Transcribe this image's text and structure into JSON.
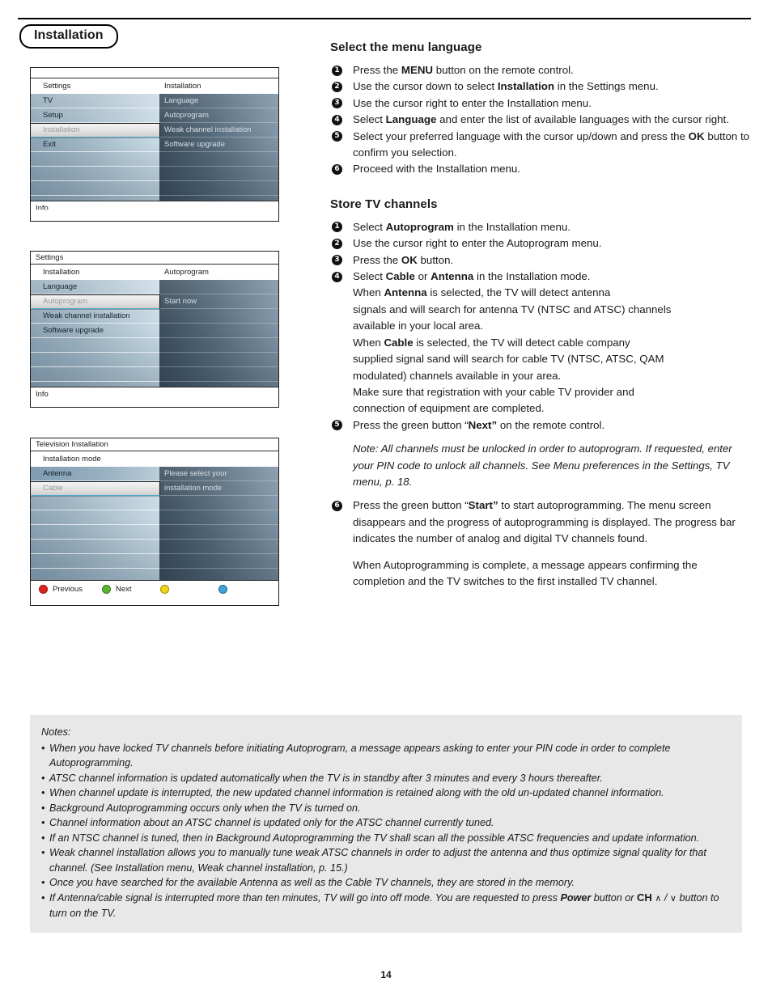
{
  "header": {
    "page_title": "Installation"
  },
  "tv_menus": [
    {
      "name": "settings-installation-menu",
      "title": "",
      "col_head_left": "Settings",
      "col_head_right": "Installation",
      "left_items": [
        {
          "label": "TV",
          "state": "normal"
        },
        {
          "label": "Setup",
          "state": "normal"
        },
        {
          "label": "Installation",
          "state": "selected"
        },
        {
          "label": "Exit",
          "state": "normal"
        },
        {
          "label": "",
          "state": "blank"
        },
        {
          "label": "",
          "state": "blank"
        },
        {
          "label": "",
          "state": "blank"
        },
        {
          "label": "",
          "state": "blank"
        }
      ],
      "right_items": [
        {
          "label": "Language",
          "state": "normal"
        },
        {
          "label": "Autoprogram",
          "state": "normal"
        },
        {
          "label": "Weak channel installation",
          "state": "normal"
        },
        {
          "label": "Software upgrade",
          "state": "normal"
        },
        {
          "label": "",
          "state": "blank"
        },
        {
          "label": "",
          "state": "blank"
        },
        {
          "label": "",
          "state": "blank"
        },
        {
          "label": "",
          "state": "blank"
        }
      ],
      "info_label": "Info"
    },
    {
      "name": "autoprogram-menu",
      "title": "Settings",
      "col_head_left": "Installation",
      "col_head_right": "Autoprogram",
      "left_items": [
        {
          "label": "Language",
          "state": "normal"
        },
        {
          "label": "Autoprogram",
          "state": "selected"
        },
        {
          "label": "Weak channel installation",
          "state": "normal"
        },
        {
          "label": "Software upgrade",
          "state": "normal"
        },
        {
          "label": "",
          "state": "blank"
        },
        {
          "label": "",
          "state": "blank"
        },
        {
          "label": "",
          "state": "blank"
        }
      ],
      "right_items": [
        {
          "label": "",
          "state": "blank"
        },
        {
          "label": "Start now",
          "state": "normal"
        },
        {
          "label": "",
          "state": "blank"
        },
        {
          "label": "",
          "state": "blank"
        },
        {
          "label": "",
          "state": "blank"
        },
        {
          "label": "",
          "state": "blank"
        },
        {
          "label": "",
          "state": "blank"
        }
      ],
      "info_label": "Info"
    },
    {
      "name": "television-installation-menu",
      "title": "Television Installation",
      "col_head_left": "Installation mode",
      "col_head_right": "",
      "left_items": [
        {
          "label": "Antenna",
          "state": "highlight"
        },
        {
          "label": "Cable",
          "state": "selected"
        },
        {
          "label": "",
          "state": "blank"
        },
        {
          "label": "",
          "state": "blank"
        },
        {
          "label": "",
          "state": "blank"
        },
        {
          "label": "",
          "state": "blank"
        },
        {
          "label": "",
          "state": "blank"
        }
      ],
      "right_items": [
        {
          "label": "Please select your",
          "state": "normal"
        },
        {
          "label": "installation mode",
          "state": "normal"
        },
        {
          "label": "",
          "state": "blank"
        },
        {
          "label": "",
          "state": "blank"
        },
        {
          "label": "",
          "state": "blank"
        },
        {
          "label": "",
          "state": "blank"
        },
        {
          "label": "",
          "state": "blank"
        }
      ],
      "color_buttons": [
        {
          "color": "#e32119",
          "label": "Previous",
          "name": "red-button"
        },
        {
          "color": "#5cb531",
          "label": "Next",
          "name": "green-button"
        },
        {
          "color": "#f2d414",
          "label": "",
          "name": "yellow-button"
        },
        {
          "color": "#3ba4d8",
          "label": "",
          "name": "blue-button"
        }
      ]
    }
  ],
  "sections": [
    {
      "heading": "Select the menu language",
      "steps": [
        [
          {
            "t": "Press the "
          },
          {
            "t": "MENU",
            "b": true
          },
          {
            "t": " button on the remote control."
          }
        ],
        [
          {
            "t": "Use the cursor down to select "
          },
          {
            "t": "Installation",
            "b": true
          },
          {
            "t": " in the Settings menu."
          }
        ],
        [
          {
            "t": "Use the cursor right to enter the Installation menu."
          }
        ],
        [
          {
            "t": "Select "
          },
          {
            "t": "Language",
            "b": true
          },
          {
            "t": " and enter the list of available languages with the cursor right."
          }
        ],
        [
          {
            "t": "Select your preferred language with the cursor up/down and press the "
          },
          {
            "t": "OK",
            "b": true
          },
          {
            "t": " button to confirm you selection."
          }
        ],
        [
          {
            "t": "Proceed with the Installation menu."
          }
        ]
      ]
    },
    {
      "heading": "Store TV channels",
      "steps": [
        [
          {
            "t": "Select "
          },
          {
            "t": "Autoprogram",
            "b": true
          },
          {
            "t": " in the Installation menu."
          }
        ],
        [
          {
            "t": "Use the cursor right to enter the Autoprogram menu."
          }
        ],
        [
          {
            "t": "Press the "
          },
          {
            "t": "OK",
            "b": true
          },
          {
            "t": " button."
          }
        ],
        [
          {
            "t": "Select "
          },
          {
            "t": "Cable",
            "b": true
          },
          {
            "t": " or "
          },
          {
            "t": "Antenna",
            "b": true
          },
          {
            "t": " in the Installation mode."
          },
          {
            "br": true
          },
          {
            "t": "When "
          },
          {
            "t": "Antenna",
            "b": true
          },
          {
            "t": " is selected, the TV will detect antenna"
          },
          {
            "br": true
          },
          {
            "t": "signals and will search for antenna TV (NTSC and ATSC) channels"
          },
          {
            "br": true
          },
          {
            "t": "available in your local area."
          },
          {
            "br": true
          },
          {
            "t": "When "
          },
          {
            "t": "Cable",
            "b": true
          },
          {
            "t": " is selected, the TV will detect cable company"
          },
          {
            "br": true
          },
          {
            "t": "supplied signal sand will search for cable TV (NTSC, ATSC, QAM"
          },
          {
            "br": true
          },
          {
            "t": "modulated) channels available in your area."
          },
          {
            "br": true
          },
          {
            "t": "Make sure that registration with your cable TV provider and"
          },
          {
            "br": true
          },
          {
            "t": "connection of equipment are completed."
          }
        ],
        [
          {
            "t": "Press the green button “"
          },
          {
            "t": "Next”",
            "b": true
          },
          {
            "t": " on the remote control."
          }
        ]
      ],
      "note": "Note: All channels must be unlocked in order to autoprogram. If requested, enter your PIN code to unlock all channels. See Menu preferences in the Settings, TV menu, p. 18.",
      "steps_after": [
        [
          {
            "t": "Press the green button “"
          },
          {
            "t": "Start”",
            "b": true
          },
          {
            "t": " to start autoprogramming. The menu screen disappears and the progress of autoprogramming is displayed. The progress bar indicates the number of analog and digital TV channels found."
          },
          {
            "gap": true
          },
          {
            "t": "When Autoprogramming is complete, a message appears confirming the completion and the TV switches to the first installed TV channel."
          }
        ]
      ],
      "steps_after_start": 6
    }
  ],
  "notes": {
    "title": "Notes:",
    "items": [
      "When you have locked TV channels before initiating Autoprogram, a message appears asking to enter your PIN code in order to complete Autoprogramming.",
      "ATSC channel information is updated automatically when the TV is in standby after 3 minutes and every 3 hours thereafter.",
      "When channel update is interrupted, the new updated channel information is retained along with the old un-updated channel information.",
      "Background Autoprogramming occurs only when the TV is turned on.",
      "Channel information about an ATSC channel is updated only for the ATSC channel currently tuned.",
      "If an NTSC channel is tuned, then in Background Autoprogramming the TV shall scan all the possible ATSC frequencies and update information.",
      "Weak channel installation allows you to manually tune weak ATSC channels in order to adjust the antenna and thus optimize signal quality for that channel. (See Installation menu, Weak channel installation, p. 15.)",
      "Once you have searched for the available Antenna as well as the Cable TV channels, they are stored in the memory."
    ],
    "last_item": {
      "part1": "If Antenna/cable signal is interrupted more than ten minutes, TV will go into off mode. You are requested to press ",
      "bold1": "Power",
      "part2": " button or ",
      "ch": "CH",
      "up": "∧",
      "slash": " / ",
      "down": "∨",
      "part3": " button to turn on the TV."
    }
  },
  "footer": {
    "page_number": "14"
  }
}
